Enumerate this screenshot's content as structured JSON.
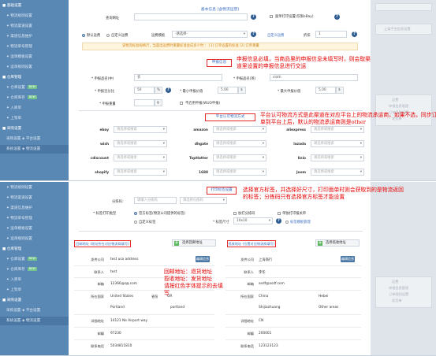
{
  "panel1": {
    "sidebar": {
      "items": [
        {
          "label": "■ 基础设置",
          "head": true
        },
        {
          "label": "✦ 物流规则设置"
        },
        {
          "label": "✦ 物流渠道设置"
        },
        {
          "label": "✦ 渠道信息维护"
        },
        {
          "label": "✦ 物流单号管理"
        },
        {
          "label": "✦ 运单模板设置"
        },
        {
          "label": "✦ 运单规则设置"
        },
        {
          "label": "■ 仓库管理",
          "head": true
        },
        {
          "label": "✦ 仓库设置",
          "badge": "NEW"
        },
        {
          "label": "✦ 仓库库存",
          "badge": "NEW"
        },
        {
          "label": "✦ 入库单"
        },
        {
          "label": "✦ 上架单"
        },
        {
          "label": "■ 采购设置",
          "head": true
        },
        {
          "label": "采购设置 ◈ 平台设置"
        },
        {
          "label": "系统设置 ◈ 物流设置",
          "sel": true
        }
      ]
    },
    "section_basic": "基本信息 (含物流运营)",
    "fields": {
      "service_url_label": "查询网址",
      "label_print_label": "面单打印设置(仅限eBay)",
      "default_service_label": "默认运费",
      "custom_service_label": "自定义运费",
      "shipping_template_label": "运费模板",
      "shipping_template_value": "-请选择-",
      "custom_shipping_label": "自定义运费",
      "discount_label": "折扣",
      "discount_value": "1"
    },
    "warning": "该物流标准规格尺，当超出运费时重量标准会成多少时 ： [1] 订单设置的标准 [2] 订单重量",
    "declare_box": "申报信息",
    "declare_note": "申报信息必填，当商品里的申报信息未填写时，则会取渠道里设置的申报信息进行交运",
    "declare": {
      "cn_name_label": "* 申报品名(中)",
      "cn_name_value": "衣",
      "en_name_label": "* 申报品名(英)",
      "en_name_value": "cloth",
      "ratio_label": "* 申报百分比",
      "ratio_value": "50",
      "ratio_unit": "%",
      "min_value_label": "* 最小申报价值",
      "min_value_value": "5.00",
      "unit_usd": "$",
      "max_value_label": "* 最大申报价值",
      "max_value_value": "5.00",
      "weight_label": "* 申报重量",
      "weight_value": "",
      "weight_unit": "g",
      "no_declare_label": "不启用申报(WUO申报)"
    },
    "platform_box": "平台认可物流方式",
    "platform_note": "平台认可物流方式是此渠道在对应平台上的物流承运商，如果不选，同步订单到平台上后，默认的物流承运商则是other",
    "platforms": [
      {
        "name": "ebay",
        "placeholder": "请选择或搜索"
      },
      {
        "name": "amazon",
        "placeholder": "请选择或搜索"
      },
      {
        "name": "aliexpress",
        "placeholder": "请选择或搜索"
      },
      {
        "name": "wish",
        "placeholder": "请选择或搜索"
      },
      {
        "name": "dhgate",
        "placeholder": "请选择或搜索"
      },
      {
        "name": "lazada",
        "placeholder": "请选择或搜索"
      },
      {
        "name": "cdiscount",
        "placeholder": "请选择或搜索"
      },
      {
        "name": "TopHatter",
        "placeholder": "请选择或搜索"
      },
      {
        "name": "linio",
        "placeholder": "请选择或搜索"
      },
      {
        "name": "shopify",
        "placeholder": "请选择或搜索"
      },
      {
        "name": "1688",
        "placeholder": "请选择或搜索"
      },
      {
        "name": "Joom",
        "placeholder": "请选择或搜索"
      }
    ],
    "right_links": [
      "上架平台信息设置",
      "运费",
      "申报信息管理",
      "订单规则设置",
      "发货单"
    ]
  },
  "panel2": {
    "sidebar": {
      "items": [
        {
          "label": "✦ 物流规则设置"
        },
        {
          "label": "✦ 物流渠道设置"
        },
        {
          "label": "✦ 渠道信息维护"
        },
        {
          "label": "✦ 物流单号管理"
        },
        {
          "label": "✦ 运单模板设置"
        },
        {
          "label": "✦ 运单规则设置"
        },
        {
          "label": "■ 仓库管理",
          "head": true
        },
        {
          "label": "✦ 仓库设置",
          "badge": "NEW"
        },
        {
          "label": "✦ 仓库库存",
          "badge": "NEW"
        },
        {
          "label": "✦ 入库单"
        },
        {
          "label": "✦ 上架单"
        },
        {
          "label": "■ 采购设置",
          "head": true
        },
        {
          "label": "采购设置 ◈ 平台设置"
        },
        {
          "label": "系统设置 ◈ 物流设置",
          "sel": true
        }
      ]
    },
    "print_box": "打印标签设置",
    "print_note": "选择官方标签，并选择好尺寸，打印面单时则会获取到的是物流返回的标签；分拣码只有选择官方标签才能设置",
    "label_choice_label": "分拣码：",
    "label_choice_placeholder": "请输入分拣码",
    "label_choice_select": "请选择分拣码",
    "print_method_label": "* 标签打印类型",
    "official_label": "官方标签(物流公司提供的标签)",
    "custom_label": "自定义标签",
    "print_sorting_label": "加打分拣码",
    "print_package_label": "单独打印报关单",
    "label_size_label": "* 标签尺寸",
    "label_size_value": "10x10",
    "label_template_label": "标签模板管理",
    "return_box": "回邮地址 (地址所在对应物流商填写)",
    "ship_box": "揽收地址 (位置对应物流商填写)",
    "select_addr_btn": "选择回邮地址",
    "select_ship_btn": "选择揽收地址",
    "addr_note": "回邮地址：退货地址\n揽收地址：发货地址\n请按红色字体提示的去填写",
    "return_addr": {
      "company_label": "发件公司",
      "company_value": "test usa address",
      "edit_btn": "编辑信息",
      "contact_label": "联系人",
      "contact_value": "test",
      "email_label": "邮箱",
      "email_value": "12366@qq.com",
      "city_label": "城市",
      "city_value": "Portland",
      "country_label": "所在国家",
      "country_value": "United States",
      "state_label": "省份",
      "state_value": "OR",
      "state_value2": "portland",
      "address_label": "详细地址",
      "address_value": "14121 Ne Airport way",
      "zip_label": "邮编",
      "zip_value": "97230",
      "phone_label": "联系电话",
      "phone_value": "5034811810"
    },
    "ship_addr": {
      "company_label": "发件公司",
      "company_value": "上海商行",
      "edit_btn": "编辑信息",
      "contact_label": "联系人",
      "contact_value": "李华",
      "email_label": "邮箱",
      "email_value": "asdf@asdf.com",
      "country_label": "所在国家",
      "country_value": "China",
      "state_value": "Hebei",
      "city_value": "Shijiazhuang",
      "district_value": "Other areas",
      "address_label": "详细地址",
      "address_value": "CN",
      "zip_label": "邮编",
      "zip_value": "200001",
      "phone_label": "联系电话",
      "phone_value": "123123123"
    },
    "right_links": [
      "运费",
      "申报信息管理",
      "订单规则设置",
      "发货单"
    ]
  },
  "colors": {
    "sidebar": "#5a88b5",
    "accent": "#4a77a3",
    "annotation_red": "#e60000",
    "help_icon": "#2f5d92"
  }
}
